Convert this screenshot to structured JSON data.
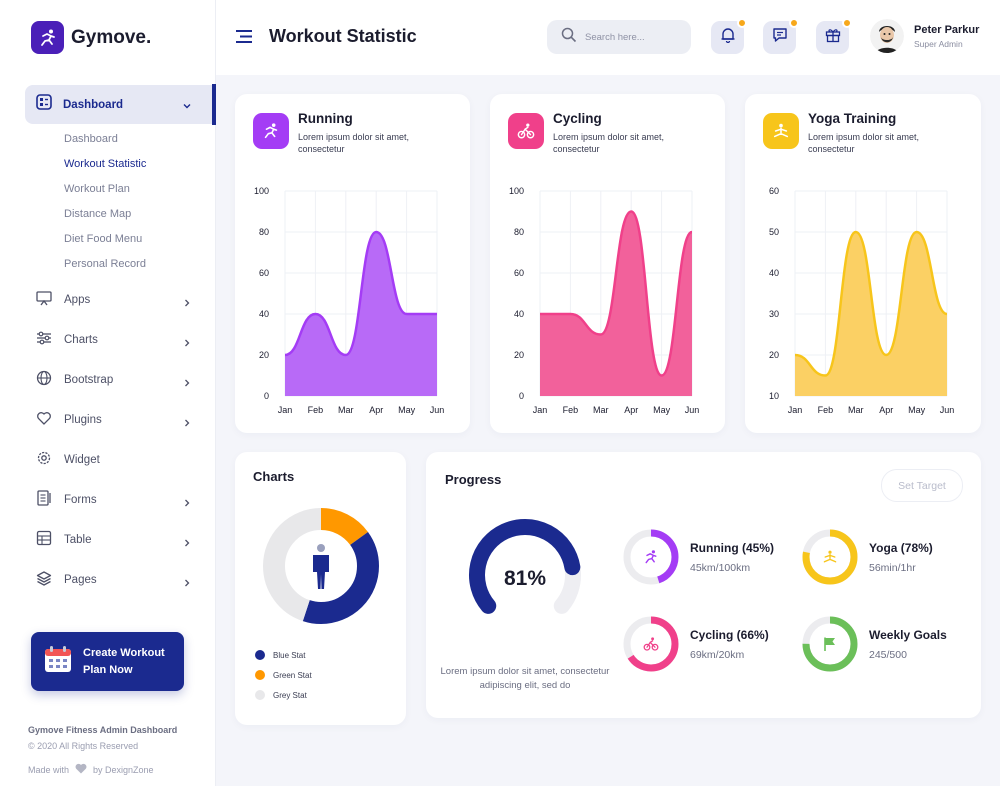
{
  "app": {
    "name": "Gymove.",
    "page_title": "Workout Statistic"
  },
  "search": {
    "placeholder": "Search here..."
  },
  "profile": {
    "name": "Peter Parkur",
    "role": "Super Admin"
  },
  "sidebar": {
    "active": {
      "label": "Dashboard"
    },
    "sub_items": [
      "Dashboard",
      "Workout Statistic",
      "Workout Plan",
      "Distance Map",
      "Diet Food Menu",
      "Personal Record"
    ],
    "items": [
      {
        "label": "Apps",
        "icon": "monitor-icon"
      },
      {
        "label": "Charts",
        "icon": "sliders-icon"
      },
      {
        "label": "Bootstrap",
        "icon": "globe-icon"
      },
      {
        "label": "Plugins",
        "icon": "heart-icon"
      },
      {
        "label": "Widget",
        "icon": "gear-icon"
      },
      {
        "label": "Forms",
        "icon": "form-icon"
      },
      {
        "label": "Table",
        "icon": "table-icon"
      },
      {
        "label": "Pages",
        "icon": "layers-icon"
      }
    ],
    "cta": "Create Workout Plan Now",
    "footer_title": "Gymove Fitness Admin Dashboard",
    "footer_copy": "© 2020 All Rights Reserved",
    "footer_made_with": "Made with",
    "footer_by": "by DexignZone"
  },
  "stat_cards": [
    {
      "title": "Running",
      "desc": "Lorem ipsum dolor sit amet, consectetur",
      "color": "#a43cf5",
      "fill": "#b86af7",
      "chart_data": {
        "type": "area",
        "x": [
          "Jan",
          "Feb",
          "Mar",
          "Apr",
          "May",
          "Jun"
        ],
        "y": [
          20,
          40,
          20,
          80,
          40,
          40
        ],
        "ylim": [
          0,
          100
        ],
        "yticks": [
          0,
          20,
          40,
          60,
          80,
          100
        ]
      }
    },
    {
      "title": "Cycling",
      "desc": "Lorem ipsum dolor sit amet, consectetur",
      "color": "#f0408a",
      "fill": "#f2619b",
      "chart_data": {
        "type": "area",
        "x": [
          "Jan",
          "Feb",
          "Mar",
          "Apr",
          "May",
          "Jun"
        ],
        "y": [
          40,
          40,
          30,
          90,
          10,
          80
        ],
        "ylim": [
          0,
          100
        ],
        "yticks": [
          0,
          20,
          40,
          60,
          80,
          100
        ]
      }
    },
    {
      "title": "Yoga Training",
      "desc": "Lorem ipsum dolor sit amet, consectetur",
      "color": "#f7c51b",
      "fill": "#fbd064",
      "chart_data": {
        "type": "area",
        "x": [
          "Jan",
          "Feb",
          "Mar",
          "Apr",
          "May",
          "Jun"
        ],
        "y": [
          20,
          15,
          50,
          20,
          50,
          30
        ],
        "ylim": [
          10,
          60
        ],
        "yticks": [
          10,
          20,
          30,
          40,
          50,
          60
        ]
      }
    }
  ],
  "charts_card": {
    "title": "Charts",
    "chart_data": {
      "type": "pie",
      "series": [
        {
          "name": "Blue Stat",
          "value": 40,
          "color": "#1b2a8f"
        },
        {
          "name": "Green Stat",
          "value": 15,
          "color": "#ff9800"
        },
        {
          "name": "Grey Stat",
          "value": 45,
          "color": "#e8e8ea"
        }
      ]
    }
  },
  "progress": {
    "title": "Progress",
    "set_target": "Set Target",
    "overall": {
      "value": "81%",
      "fraction": 0.81
    },
    "note": "Lorem ipsum dolor sit amet, consectetur adipiscing elit, sed do",
    "items": [
      {
        "label": "Running (45%)",
        "value": "45km/100km",
        "fraction": 0.45,
        "color": "#a43cf5",
        "icon": "running-icon"
      },
      {
        "label": "Yoga (78%)",
        "value": "56min/1hr",
        "fraction": 0.78,
        "color": "#f7c51b",
        "icon": "yoga-icon"
      },
      {
        "label": "Cycling (66%)",
        "value": "69km/20km",
        "fraction": 0.66,
        "color": "#f0408a",
        "icon": "cycling-icon"
      },
      {
        "label": "Weekly Goals",
        "value": "245/500",
        "fraction": 0.75,
        "color": "#6bbf59",
        "icon": "flag-icon"
      }
    ]
  }
}
